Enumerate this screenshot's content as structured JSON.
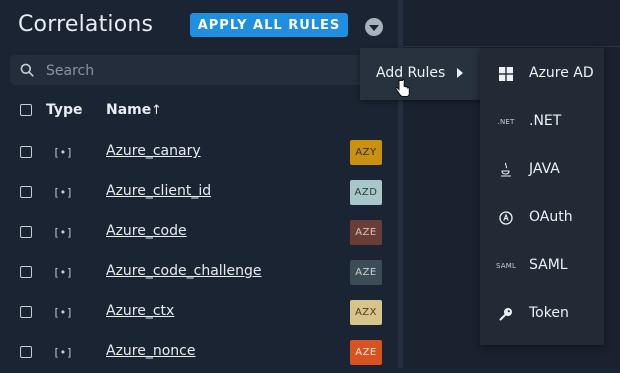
{
  "header": {
    "title": "Correlations",
    "apply_all_label": "APPLY ALL RULES"
  },
  "search": {
    "placeholder": "Search",
    "value": ""
  },
  "table": {
    "columns": {
      "type": "Type",
      "name": "Name",
      "sort_indicator": "↑"
    },
    "type_glyph": "[•]",
    "rows": [
      {
        "name": "Azure_canary",
        "badge": "AZY",
        "badge_bg": "#c8920f",
        "badge_fg": "#3a2a05"
      },
      {
        "name": "Azure_client_id",
        "badge": "AZD",
        "badge_bg": "#a8c7c9",
        "badge_fg": "#2c3b3d"
      },
      {
        "name": "Azure_code",
        "badge": "AZE",
        "badge_bg": "#6a3e36",
        "badge_fg": "#d9c2bd"
      },
      {
        "name": "Azure_code_challenge",
        "badge": "AZE",
        "badge_bg": "#3d4d56",
        "badge_fg": "#c7d0d6"
      },
      {
        "name": "Azure_ctx",
        "badge": "AZX",
        "badge_bg": "#d7c48a",
        "badge_fg": "#4a4020"
      },
      {
        "name": "Azure_nonce",
        "badge": "AZE",
        "badge_bg": "#d8531f",
        "badge_fg": "#fbe3d8"
      }
    ]
  },
  "context_menu": {
    "add_rules_label": "Add Rules"
  },
  "submenu": {
    "items": [
      {
        "label": "Azure AD",
        "icon": "windows-icon"
      },
      {
        "label": ".NET",
        "icon": "dotnet-icon",
        "icon_text": ".NET"
      },
      {
        "label": "JAVA",
        "icon": "java-icon"
      },
      {
        "label": "OAuth",
        "icon": "oauth-icon"
      },
      {
        "label": "SAML",
        "icon": "saml-icon",
        "icon_text": "SAML"
      },
      {
        "label": "Token",
        "icon": "key-icon"
      }
    ]
  },
  "colors": {
    "background": "#1b2432",
    "accent": "#1e8fe1",
    "menu_bg": "#28313e",
    "submenu_bg": "#222a36"
  }
}
